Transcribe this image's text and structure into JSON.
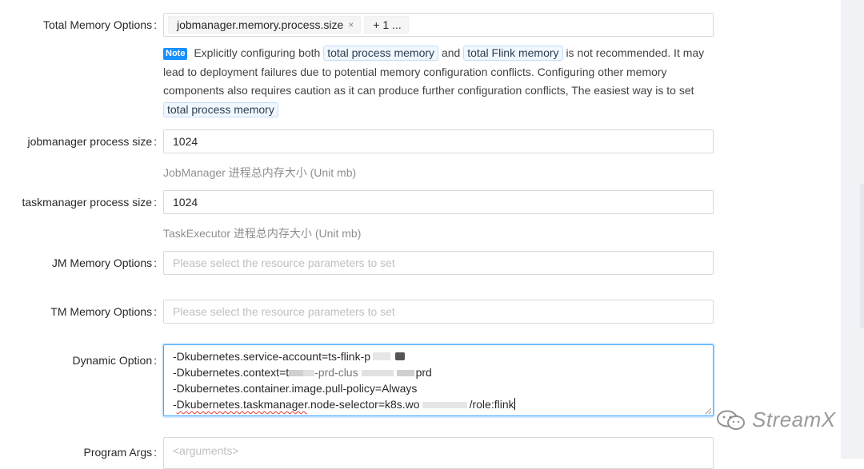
{
  "total_memory_options": {
    "label": "Total Memory Options",
    "tag": "jobmanager.memory.process.size",
    "tag_remove": "×",
    "more": "+ 1 ..."
  },
  "note": {
    "badge": "Note",
    "t1": "Explicitly configuring both",
    "c1": "total process memory",
    "t2": "and",
    "c2": "total Flink memory",
    "t3": "is not recommended. It may lead to deployment failures due to potential memory configuration conflicts. Configuring other memory components also requires caution as it can produce further configuration conflicts, The easiest way is to set",
    "c3": "total process memory"
  },
  "jobmanager_process_size": {
    "label": "jobmanager process size",
    "value": "1024",
    "help": "JobManager 进程总内存大小 (Unit mb)"
  },
  "taskmanager_process_size": {
    "label": "taskmanager process size",
    "value": "1024",
    "help": "TaskExecutor 进程总内存大小 (Unit mb)"
  },
  "jm_memory_options": {
    "label": "JM Memory Options",
    "placeholder": "Please select the resource parameters to set"
  },
  "tm_memory_options": {
    "label": "TM Memory Options",
    "placeholder": "Please select the resource parameters to set"
  },
  "dynamic_option": {
    "label": "Dynamic Option",
    "lines": [
      "-Dkubernetes.service-account=ts-flink-p",
      "-Dkubernetes.context=t",
      "-Dkubernetes.container.image.pull-policy=Always",
      "-Dkubernetes.taskmanager.node-selector=k8s.wo"
    ],
    "line2_tail": "-prd-clus",
    "line2_end": "prd",
    "line4_underlined": "Dkubernetes.taskmanager",
    "line4_end": "/role:flink"
  },
  "program_args": {
    "label": "Program Args",
    "placeholder": "<arguments>"
  },
  "colon": ":",
  "watermark": "StreamX",
  "colors": {
    "accent": "#1890ff",
    "border": "#d9d9d9",
    "placeholder": "#bfbfbf"
  }
}
